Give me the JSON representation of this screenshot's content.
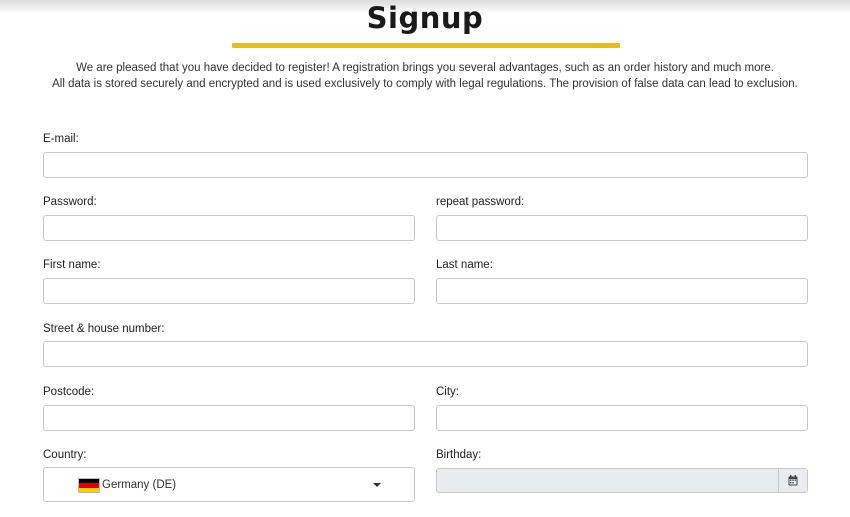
{
  "page": {
    "title": "Signup",
    "intro_line1": "We are pleased that you have decided to register! A registration brings you several advantages, such as an order history and much more.",
    "intro_line2": "All data is stored securely and encrypted and is used exclusively to comply with legal regulations. The provision of false data can lead to exclusion.",
    "accent_color": "#e2bb2a"
  },
  "form": {
    "email": {
      "label": "E-mail:",
      "value": ""
    },
    "password": {
      "label": "Password:",
      "value": ""
    },
    "repeat_password": {
      "label": "repeat password:",
      "value": ""
    },
    "first_name": {
      "label": "First name:",
      "value": ""
    },
    "last_name": {
      "label": "Last name:",
      "value": ""
    },
    "street": {
      "label": "Street & house number:",
      "value": ""
    },
    "postcode": {
      "label": "Postcode:",
      "value": ""
    },
    "city": {
      "label": "City:",
      "value": ""
    },
    "country": {
      "label": "Country:",
      "selected": "Germany (DE)",
      "flag_icon": "flag-de-icon"
    },
    "birthday": {
      "label": "Birthday:",
      "value": "",
      "button_icon": "calendar-icon"
    }
  }
}
